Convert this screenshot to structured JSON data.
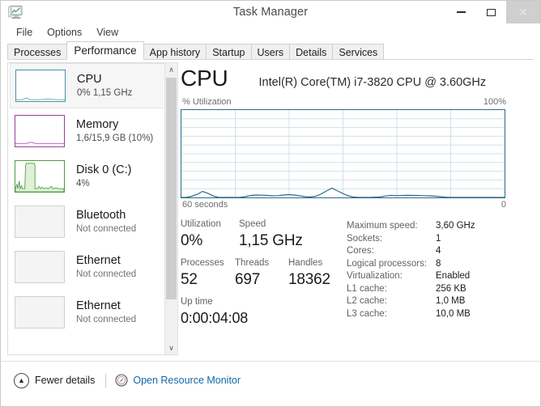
{
  "window": {
    "title": "Task Manager",
    "icon": "task-manager-monitor-icon",
    "buttons": {
      "minimize": "–",
      "maximize": "☐",
      "close": "✕"
    }
  },
  "menu": {
    "items": [
      "File",
      "Options",
      "View"
    ]
  },
  "tabs": [
    {
      "label": "Processes",
      "active": false
    },
    {
      "label": "Performance",
      "active": true
    },
    {
      "label": "App history",
      "active": false
    },
    {
      "label": "Startup",
      "active": false
    },
    {
      "label": "Users",
      "active": false
    },
    {
      "label": "Details",
      "active": false
    },
    {
      "label": "Services",
      "active": false
    }
  ],
  "sidebar": {
    "items": [
      {
        "title": "CPU",
        "sub": "0%  1,15 GHz",
        "accent": "#4a93a8",
        "selected": true,
        "graph": "cpu"
      },
      {
        "title": "Memory",
        "sub": "1,6/15,9 GB (10%)",
        "accent": "#9a3ea1",
        "selected": false,
        "graph": "memory"
      },
      {
        "title": "Disk 0 (C:)",
        "sub": "4%",
        "accent": "#4f9a45",
        "selected": false,
        "graph": "disk"
      },
      {
        "title": "Bluetooth",
        "sub": "Not connected",
        "accent": "#d0d0d0",
        "selected": false,
        "graph": "blank"
      },
      {
        "title": "Ethernet",
        "sub": "Not connected",
        "accent": "#d0d0d0",
        "selected": false,
        "graph": "blank"
      },
      {
        "title": "Ethernet",
        "sub": "Not connected",
        "accent": "#d0d0d0",
        "selected": false,
        "graph": "blank"
      }
    ],
    "scrollbar": {
      "up": "∧",
      "down": "∨"
    }
  },
  "main": {
    "title": "CPU",
    "subtitle": "Intel(R) Core(TM) i7-3820 CPU @ 3.60GHz",
    "axis_label": "% Utilization",
    "axis_max": "100%",
    "time_start": "60 seconds",
    "time_end": "0",
    "stats": {
      "row1": [
        {
          "label": "Utilization",
          "value": "0%"
        },
        {
          "label": "Speed",
          "value": "1,15 GHz"
        }
      ],
      "row2": [
        {
          "label": "Processes",
          "value": "52"
        },
        {
          "label": "Threads",
          "value": "697"
        },
        {
          "label": "Handles",
          "value": "18362"
        }
      ],
      "row3": [
        {
          "label": "Up time",
          "value": "0:00:04:08"
        }
      ]
    },
    "info": [
      {
        "key": "Maximum speed:",
        "value": "3,60 GHz"
      },
      {
        "key": "Sockets:",
        "value": "1"
      },
      {
        "key": "Cores:",
        "value": "4"
      },
      {
        "key": "Logical processors:",
        "value": "8"
      },
      {
        "key": "Virtualization:",
        "value": "Enabled"
      },
      {
        "key": "L1 cache:",
        "value": "256 KB"
      },
      {
        "key": "L2 cache:",
        "value": "1,0 MB"
      },
      {
        "key": "L3 cache:",
        "value": "10,0 MB"
      }
    ]
  },
  "footer": {
    "fewer_details": "Fewer details",
    "fewer_icon": "chevron-up-circle-icon",
    "resource_monitor": "Open Resource Monitor",
    "resource_icon": "resource-monitor-icon"
  },
  "colors": {
    "cpu_line": "#2b6a85",
    "cpu_grid": "#cfe2ea",
    "memory": "#9a3ea1",
    "disk": "#4f9a45",
    "link": "#1266a8",
    "close_hover": "#cfcfcf"
  },
  "chart_data": {
    "type": "line",
    "title": "CPU",
    "subtitle": "Intel(R) Core(TM) i7-3820 CPU @ 3.60GHz",
    "ylabel": "% Utilization",
    "xlabel": "",
    "ylim": [
      0,
      100
    ],
    "xlim": [
      60,
      0
    ],
    "x_tick_labels": [
      "60 seconds",
      "0"
    ],
    "y_tick_labels": [
      "100%"
    ],
    "grid": true,
    "grid_cols": 6,
    "grid_rows": 10,
    "legend": "none",
    "series": [
      {
        "name": "% Utilization",
        "color": "#2b6a85",
        "fill": "#cfe8f2",
        "values": [
          0,
          0,
          1,
          0,
          1,
          3,
          5,
          3,
          1,
          0,
          0,
          0,
          0,
          0,
          0,
          0,
          0,
          1,
          2,
          3,
          3,
          2,
          2,
          2,
          2,
          2,
          2,
          1,
          1,
          2,
          3,
          3,
          2,
          1,
          1,
          0,
          1,
          3,
          6,
          4,
          2,
          1,
          0,
          0,
          0,
          0,
          1,
          2,
          2,
          2,
          1,
          2,
          2,
          2,
          2,
          2,
          2,
          2,
          2,
          1,
          1
        ]
      }
    ]
  }
}
